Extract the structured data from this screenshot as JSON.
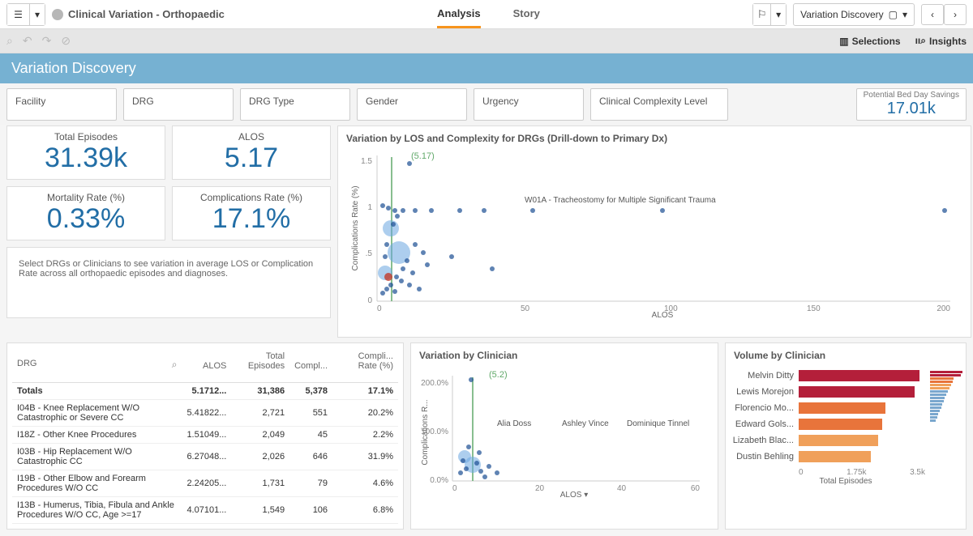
{
  "app_title": "Clinical Variation - Orthopaedic",
  "tabs": {
    "analysis": "Analysis",
    "story": "Story"
  },
  "sheet_dropdown": "Variation Discovery",
  "toolbar": {
    "selections": "Selections",
    "insights": "Insights"
  },
  "banner_title": "Variation Discovery",
  "filters": [
    "Facility",
    "DRG",
    "DRG Type",
    "Gender",
    "Urgency",
    "Clinical Complexity Level"
  ],
  "potential_savings": {
    "label": "Potential Bed Day Savings",
    "value": "17.01k"
  },
  "kpis": {
    "total_episodes": {
      "label": "Total Episodes",
      "value": "31.39k"
    },
    "alos": {
      "label": "ALOS",
      "value": "5.17"
    },
    "mortality": {
      "label": "Mortality Rate (%)",
      "value": "0.33%"
    },
    "complications": {
      "label": "Complications Rate (%)",
      "value": "17.1%"
    }
  },
  "note_text": "Select DRGs or Clinicians to see variation in average LOS or Complication Rate across all orthopaedic episodes and diagnoses.",
  "chart_titles": {
    "scatter_main": "Variation by LOS and Complexity for DRGs (Drill-down to Primary Dx)",
    "scatter_clinician": "Variation by Clinician",
    "bar_clinician": "Volume by Clinician"
  },
  "chart_data": [
    {
      "name": "variation_los_complexity",
      "type": "scatter",
      "xlabel": "ALOS",
      "ylabel": "Complications Rate (%)",
      "xlim": [
        0,
        200
      ],
      "ylim": [
        0,
        1.6
      ],
      "ref_x": 5.17,
      "ref_label": "(5.17)",
      "annotation": "W01A - Tracheostomy for Multiple Significant Trauma",
      "points_dense_cluster": {
        "x_range": [
          0,
          15
        ],
        "y_range": [
          0,
          1.1
        ],
        "count_approx": 120
      },
      "outliers": [
        {
          "x": 20,
          "y": 1.0
        },
        {
          "x": 30,
          "y": 1.0
        },
        {
          "x": 45,
          "y": 1.0
        },
        {
          "x": 55,
          "y": 1.0
        },
        {
          "x": 100,
          "y": 1.0
        },
        {
          "x": 195,
          "y": 1.0
        },
        {
          "x": 11,
          "y": 1.5
        },
        {
          "x": 25,
          "y": 0.5
        },
        {
          "x": 40,
          "y": 0.35
        }
      ]
    },
    {
      "name": "variation_by_clinician",
      "type": "scatter",
      "xlabel": "ALOS",
      "ylabel": "Complications R...",
      "xlim": [
        0,
        60
      ],
      "ylim": [
        0,
        220
      ],
      "ref_x": 5.2,
      "ref_label": "(5.2)",
      "labeled_points": [
        {
          "label": "Alia Doss",
          "x": 9,
          "y": 68
        },
        {
          "label": "Ashley Vince",
          "x": 25,
          "y": 68
        },
        {
          "label": "Dominique Tinnel",
          "x": 42,
          "y": 68
        }
      ],
      "points_cluster": {
        "x_range": [
          2,
          12
        ],
        "y_range": [
          0,
          60
        ],
        "count_approx": 60
      },
      "outlier": {
        "x": 5,
        "y": 210
      }
    },
    {
      "name": "volume_by_clinician",
      "type": "bar",
      "xlabel": "Total Episodes",
      "xlim": [
        0,
        3500
      ],
      "x_ticks": [
        "0",
        "1.75k",
        "3.5k"
      ],
      "series": [
        {
          "name": "Melvin Ditty",
          "value": 3350,
          "color": "#b41f3a"
        },
        {
          "name": "Lewis Morejon",
          "value": 3200,
          "color": "#b41f3a"
        },
        {
          "name": "Florencio Mo...",
          "value": 2400,
          "color": "#e8743b"
        },
        {
          "name": "Edward Gols...",
          "value": 2300,
          "color": "#e8743b"
        },
        {
          "name": "Lizabeth Blac...",
          "value": 2200,
          "color": "#f0a05a"
        },
        {
          "name": "Dustin Behling",
          "value": 2000,
          "color": "#f0a05a"
        }
      ]
    }
  ],
  "table": {
    "columns": [
      "DRG",
      "ALOS",
      "Total Episodes",
      "Compl...",
      "Compli... Rate (%)"
    ],
    "totals": {
      "drg": "Totals",
      "alos": "5.1712...",
      "episodes": "31,386",
      "compl": "5,378",
      "rate": "17.1%"
    },
    "rows": [
      {
        "drg": "I04B - Knee Replacement W/O Catastrophic or Severe CC",
        "alos": "5.41822...",
        "episodes": "2,721",
        "compl": "551",
        "rate": "20.2%"
      },
      {
        "drg": "I18Z - Other Knee Procedures",
        "alos": "1.51049...",
        "episodes": "2,049",
        "compl": "45",
        "rate": "2.2%"
      },
      {
        "drg": "I03B - Hip Replacement W/O Catastrophic CC",
        "alos": "6.27048...",
        "episodes": "2,026",
        "compl": "646",
        "rate": "31.9%"
      },
      {
        "drg": "I19B - Other Elbow and Forearm Procedures W/O CC",
        "alos": "2.24205...",
        "episodes": "1,731",
        "compl": "79",
        "rate": "4.6%"
      },
      {
        "drg": "I13B - Humerus, Tibia, Fibula and Ankle Procedures W/O CC, Age >=17",
        "alos": "4.07101...",
        "episodes": "1,549",
        "compl": "106",
        "rate": "6.8%"
      }
    ]
  }
}
